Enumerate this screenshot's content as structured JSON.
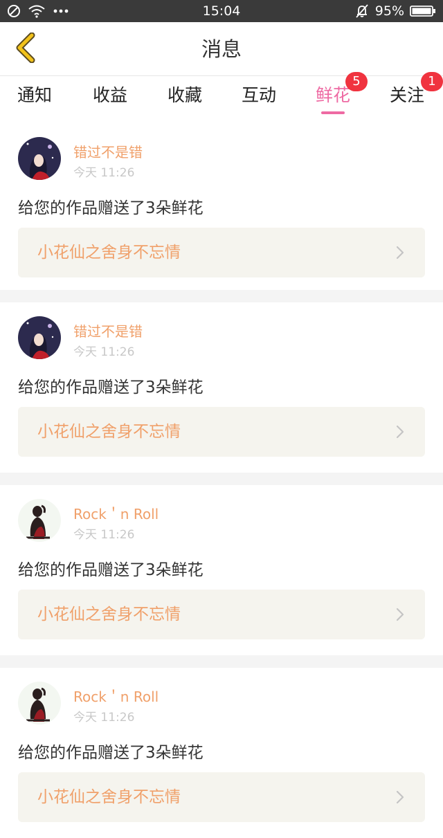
{
  "status_bar": {
    "time": "15:04",
    "battery": "95%"
  },
  "header": {
    "title": "消息"
  },
  "tabs": [
    {
      "label": "通知"
    },
    {
      "label": "收益"
    },
    {
      "label": "收藏"
    },
    {
      "label": "互动"
    },
    {
      "label": "鲜花",
      "badge": "5",
      "active": true
    },
    {
      "label": "关注",
      "badge": "1"
    }
  ],
  "notifications": [
    {
      "user": "错过不是错",
      "time": "今天 11:26",
      "message": "给您的作品赠送了3朵鲜花",
      "work": "小花仙之舍身不忘情"
    },
    {
      "user": "错过不是错",
      "time": "今天 11:26",
      "message": "给您的作品赠送了3朵鲜花",
      "work": "小花仙之舍身不忘情"
    },
    {
      "user": "Rock＇n Roll",
      "time": "今天 11:26",
      "message": "给您的作品赠送了3朵鲜花",
      "work": "小花仙之舍身不忘情"
    },
    {
      "user": "Rock＇n Roll",
      "time": "今天 11:26",
      "message": "给您的作品赠送了3朵鲜花",
      "work": "小花仙之舍身不忘情"
    }
  ],
  "colors": {
    "accent": "#ee6aa3",
    "badge": "#f0333f",
    "username": "#f0a06a",
    "back_arrow": "#f2c21b"
  },
  "icons": [
    "no-sim-icon",
    "wifi-icon",
    "more-dots-icon",
    "mute-bell-icon",
    "battery-icon",
    "back-arrow-icon",
    "chevron-right-icon"
  ]
}
